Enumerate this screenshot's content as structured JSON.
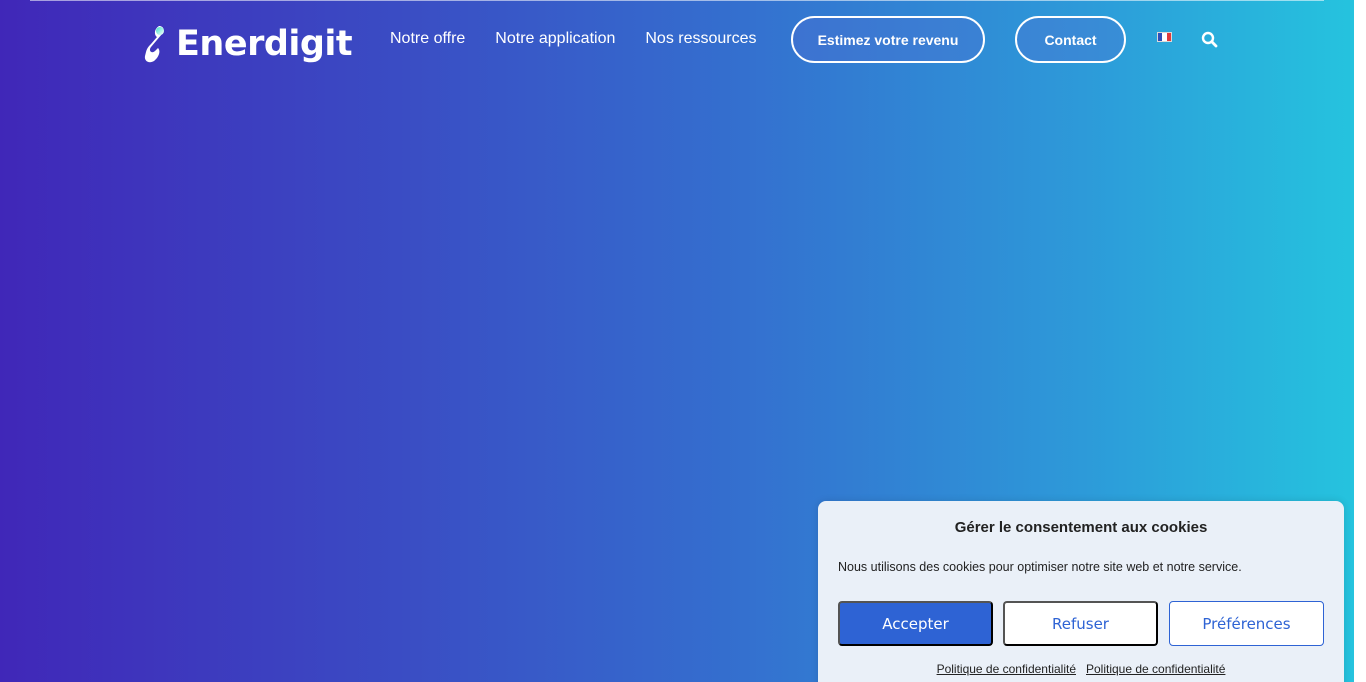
{
  "brand": {
    "name": "Enerdigit"
  },
  "nav": {
    "items": [
      {
        "label": "Notre offre"
      },
      {
        "label": "Notre application"
      },
      {
        "label": "Nos ressources"
      }
    ],
    "estimate_label": "Estimez votre revenu",
    "contact_label": "Contact",
    "language_icon": "french-flag-icon",
    "search_icon": "search-icon"
  },
  "colors": {
    "gradient_start": "#4027b8",
    "gradient_end": "#25c3de",
    "cookie_primary": "#2e63d4",
    "cookie_bg": "#eaf0f8"
  },
  "cookie_banner": {
    "title": "Gérer le consentement aux cookies",
    "message": "Nous utilisons des cookies pour optimiser notre site web et notre service.",
    "accept_label": "Accepter",
    "refuse_label": "Refuser",
    "preferences_label": "Préférences",
    "links": [
      {
        "label": "Politique de confidentialité"
      },
      {
        "label": "Politique de confidentialité"
      }
    ]
  }
}
